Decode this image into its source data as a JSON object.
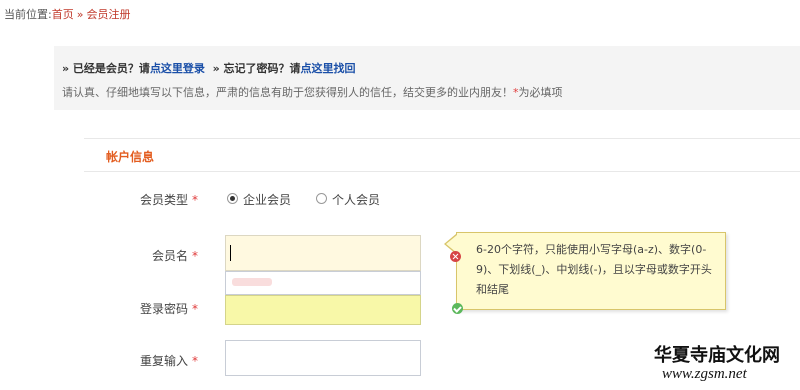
{
  "breadcrumb": {
    "prefix": "当前位置:",
    "home": "首页",
    "separator": "»",
    "current": "会员注册"
  },
  "notice": {
    "login_prompt": "» 已经是会员？请",
    "login_link": "点这里登录",
    "forgot_prompt": "» 忘记了密码？请",
    "forgot_link": "点这里找回",
    "description": "请认真、仔细地填写以下信息，严肃的信息有助于您获得别人的信任，结交更多的业内朋友！",
    "required_mark": "*",
    "required_note": "为必填项"
  },
  "section": {
    "title": "帐户信息"
  },
  "form": {
    "member_type": {
      "label": "会员类型",
      "star": "*",
      "options": [
        "企业会员",
        "个人会员"
      ],
      "selected": "企业会员"
    },
    "username": {
      "label": "会员名",
      "star": "*",
      "value": ""
    },
    "password": {
      "label": "登录密码",
      "star": "*",
      "value": ""
    },
    "repeat": {
      "label": "重复输入",
      "star": "*",
      "value": ""
    }
  },
  "tooltip": {
    "text": "6-20个字符，只能使用小写字母(a-z)、数字(0-9)、下划线(_)、中划线(-)，且以字母或数字开头和结尾"
  },
  "watermark": {
    "name": "华夏寺庙文化网",
    "url": "www.zgsm.net"
  },
  "colors": {
    "accent_orange": "#e35d20",
    "link_blue": "#1a4fa8",
    "required_red": "#e03b3b",
    "tooltip_bg": "#fffbd0"
  }
}
